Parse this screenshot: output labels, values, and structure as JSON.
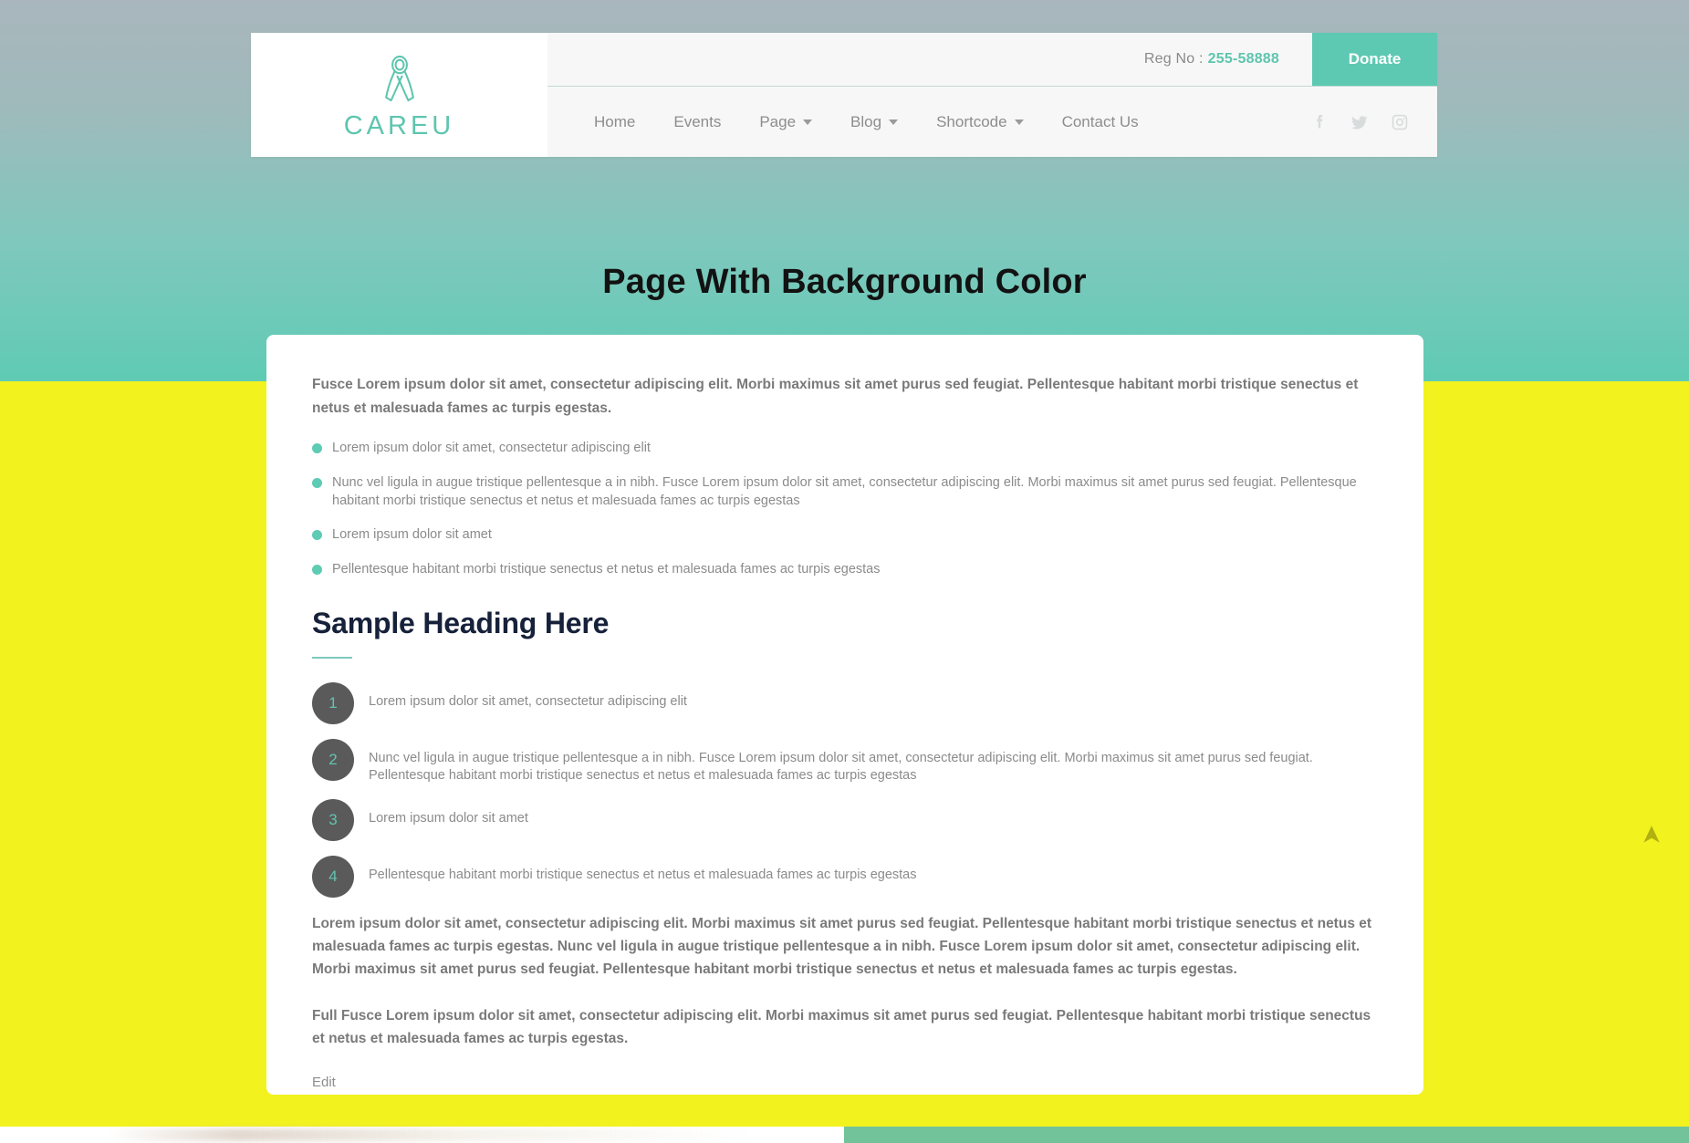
{
  "theme": {
    "accent_teal": "#5ecbb4",
    "page_background": "#f2f21f",
    "hero_gradient_top": "#a9b6bd",
    "hero_gradient_bottom": "#5fcbb4",
    "heading_navy": "#16213a",
    "badge_gray": "#5a5a5a",
    "scroll_arrow": "#b0b00f"
  },
  "header": {
    "logo": {
      "icon": "awareness-ribbon-icon",
      "text": "CAREU"
    },
    "topbar": {
      "reg_label": "Reg No :",
      "reg_value": "255-58888",
      "donate_label": "Donate"
    },
    "nav": [
      {
        "label": "Home",
        "has_dropdown": false
      },
      {
        "label": "Events",
        "has_dropdown": false
      },
      {
        "label": "Page",
        "has_dropdown": true
      },
      {
        "label": "Blog",
        "has_dropdown": true
      },
      {
        "label": "Shortcode",
        "has_dropdown": true
      },
      {
        "label": "Contact Us",
        "has_dropdown": false
      }
    ],
    "socials": [
      {
        "name": "facebook-icon"
      },
      {
        "name": "twitter-icon"
      },
      {
        "name": "instagram-icon"
      }
    ]
  },
  "hero": {
    "title": "Page With Background Color"
  },
  "content": {
    "intro_paragraph": "Fusce Lorem ipsum dolor sit amet, consectetur adipiscing elit. Morbi maximus sit amet purus sed feugiat. Pellentesque habitant morbi tristique senectus et netus et malesuada fames ac turpis egestas.",
    "bullet_items": [
      "Lorem ipsum dolor sit amet, consectetur adipiscing elit",
      "Nunc vel ligula in augue tristique pellentesque a in nibh. Fusce Lorem ipsum dolor sit amet, consectetur adipiscing elit. Morbi maximus sit amet purus sed feugiat. Pellentesque habitant morbi tristique senectus et netus et malesuada fames ac turpis egestas",
      "Lorem ipsum dolor sit amet",
      "Pellentesque habitant morbi tristique senectus et netus et malesuada fames ac turpis egestas"
    ],
    "section_heading": "Sample Heading Here",
    "numbered_items": [
      {
        "number": "1",
        "text": "Lorem ipsum dolor sit amet, consectetur adipiscing elit"
      },
      {
        "number": "2",
        "text": "Nunc vel ligula in augue tristique pellentesque a in nibh. Fusce Lorem ipsum dolor sit amet, consectetur adipiscing elit. Morbi maximus sit amet purus sed feugiat. Pellentesque habitant morbi tristique senectus et netus et malesuada fames ac turpis egestas"
      },
      {
        "number": "3",
        "text": "Lorem ipsum dolor sit amet"
      },
      {
        "number": "4",
        "text": "Pellentesque habitant morbi tristique senectus et netus et malesuada fames ac turpis egestas"
      }
    ],
    "closing_paragraph_1": "Lorem ipsum dolor sit amet, consectetur adipiscing elit. Morbi maximus sit amet purus sed feugiat. Pellentesque habitant morbi tristique senectus et netus et malesuada fames ac turpis egestas. Nunc vel ligula in augue tristique pellentesque a in nibh. Fusce Lorem ipsum dolor sit amet, consectetur adipiscing elit. Morbi maximus sit amet purus sed feugiat. Pellentesque habitant morbi tristique senectus et netus et malesuada fames ac turpis egestas.",
    "closing_paragraph_2": "Full Fusce Lorem ipsum dolor sit amet, consectetur adipiscing elit. Morbi maximus sit amet purus sed feugiat. Pellentesque habitant morbi tristique senectus et netus et malesuada fames ac turpis egestas.",
    "edit_label": "Edit"
  },
  "scroll_top": {
    "icon": "arrow-up-icon"
  }
}
